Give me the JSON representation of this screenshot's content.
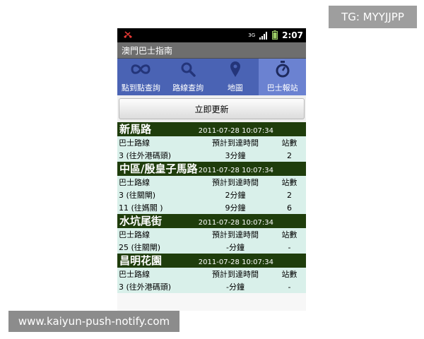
{
  "overlay": {
    "tg_label": "TG: MYYJJPP",
    "url_label": "www.kaiyun-push-notify.com"
  },
  "statusbar": {
    "time": "2:07",
    "network": "3G"
  },
  "app": {
    "title": "澳門巴士指南"
  },
  "tabs": [
    {
      "label": "點到點查詢",
      "icon": "infinity-icon"
    },
    {
      "label": "路線查詢",
      "icon": "search-icon"
    },
    {
      "label": "地圖",
      "icon": "map-pin-icon"
    },
    {
      "label": "巴士報站",
      "icon": "stopwatch-icon",
      "active": true
    }
  ],
  "refresh_button": {
    "label": "立即更新"
  },
  "columns": {
    "route": "巴士路線",
    "eta": "預計到達時間",
    "stops": "站數"
  },
  "stops": [
    {
      "name": "新馬路",
      "timestamp": "2011-07-28 10:07:34",
      "rows": [
        {
          "route": "3 (往外港碼頭)",
          "eta": "3分鐘",
          "stops": "2"
        }
      ]
    },
    {
      "name": "中區/殷皇子馬路",
      "timestamp": "2011-07-28 10:07:34",
      "rows": [
        {
          "route": "3 (往關閘)",
          "eta": "2分鐘",
          "stops": "2"
        },
        {
          "route": "11 (往媽閣 )",
          "eta": "9分鐘",
          "stops": "6"
        }
      ]
    },
    {
      "name": "水坑尾街",
      "timestamp": "2011-07-28 10:07:34",
      "rows": [
        {
          "route": "25 (往關閘)",
          "eta": "-分鐘",
          "stops": "-"
        }
      ]
    },
    {
      "name": "昌明花園",
      "timestamp": "2011-07-28 10:07:34",
      "rows": [
        {
          "route": "3 (往外港碼頭)",
          "eta": "-分鐘",
          "stops": "-"
        }
      ]
    }
  ],
  "colors": {
    "tab_bar": "#4a63b4",
    "tab_active": "#6b82d1",
    "stop_header": "#1f3d0c",
    "row_bg": "#d9f0ea",
    "missed_call": "#e53935"
  }
}
